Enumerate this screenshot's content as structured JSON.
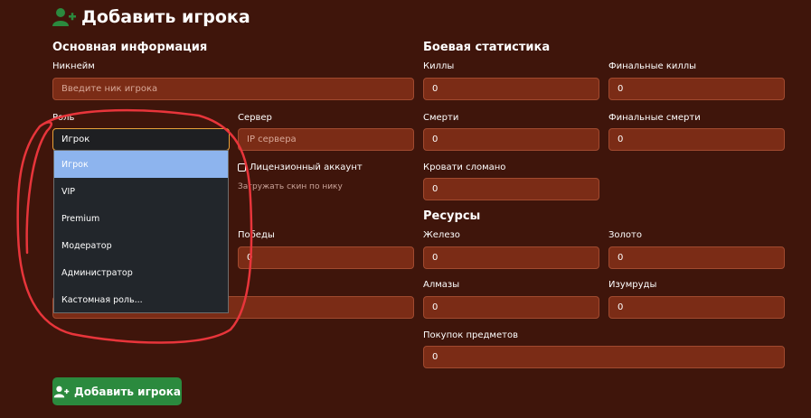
{
  "page": {
    "title": "Добавить игрока",
    "title_icon": "user-plus-icon",
    "accent_color": "#2b8a3e"
  },
  "basic": {
    "section_title": "Основная информация",
    "nickname_label": "Никнейм",
    "nickname_placeholder": "Введите ник игрока",
    "role_label": "Роль",
    "role_value": "Игрок",
    "server_label": "Сервер",
    "server_placeholder": "IP сервера",
    "license_label": "Лицензионный аккаунт",
    "skin_hint": "Загружать скин по нику",
    "wins_label": "Победы",
    "wins_value": "0"
  },
  "role_dropdown": {
    "options": [
      "Игрок",
      "VIP",
      "Premium",
      "Модератор",
      "Администратор",
      "Кастомная роль..."
    ],
    "selected_index": 0
  },
  "combat": {
    "section_title": "Боевая статистика",
    "kills_label": "Киллы",
    "kills_value": "0",
    "final_kills_label": "Финальные киллы",
    "final_kills_value": "0",
    "deaths_label": "Смерти",
    "deaths_value": "0",
    "final_deaths_label": "Финальные смерти",
    "final_deaths_value": "0",
    "beds_label": "Кровати сломано",
    "beds_value": "0"
  },
  "resources": {
    "section_title": "Ресурсы",
    "iron_label": "Железо",
    "iron_value": "0",
    "gold_label": "Золото",
    "gold_value": "0",
    "diamonds_label": "Алмазы",
    "diamonds_value": "0",
    "emeralds_label": "Изумруды",
    "emeralds_value": "0",
    "purchases_label": "Покупок предметов",
    "purchases_value": "0"
  },
  "actions": {
    "submit_label": "Добавить игрока",
    "submit_icon": "user-plus-icon"
  },
  "annotation": {
    "color": "#e8353b"
  }
}
